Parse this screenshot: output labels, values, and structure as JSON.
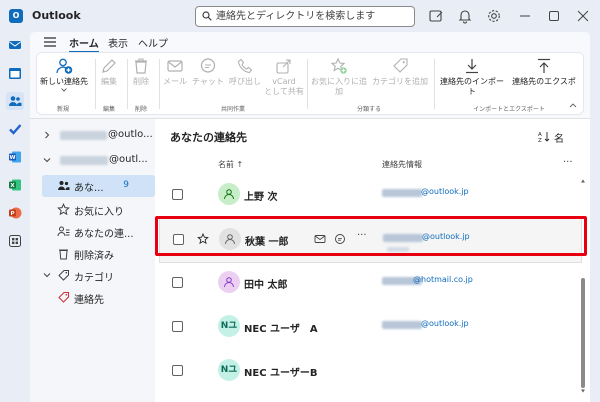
{
  "app": {
    "title": "Outlook",
    "logo_text": "O"
  },
  "search": {
    "placeholder": "連絡先とディレクトリを検索します"
  },
  "ribbon": {
    "tabs": [
      {
        "label": "ホーム",
        "active": true
      },
      {
        "label": "表示",
        "active": false
      },
      {
        "label": "ヘルプ",
        "active": false
      }
    ],
    "buttons": {
      "new_contact": "新しい連絡先",
      "edit": "編集",
      "delete": "削除",
      "mail": "メール",
      "chat": "チャット",
      "call": "呼び出し",
      "vcard_line1": "vCard",
      "vcard_line2": "として共有",
      "add_favorite": "お気に入りに追加",
      "add_category": "カテゴリを追加",
      "import_contacts": "連絡先のインポート",
      "export_contacts": "連絡先のエクスポ"
    },
    "groups": {
      "new": "新規",
      "edit": "編集",
      "delete": "削除",
      "collab": "共同作業",
      "classify": "分類する",
      "import_export": "インポートとエクスポート"
    }
  },
  "folders": {
    "account1_suffix": "@outlo...",
    "account2_suffix": "@outl...",
    "items": [
      {
        "label": "あな...",
        "badge": "9",
        "selected": true
      },
      {
        "label": "お気に入り"
      },
      {
        "label": "あなたの連..."
      },
      {
        "label": "削除済み"
      },
      {
        "label": "カテゴリ"
      },
      {
        "label": "連絡先"
      }
    ]
  },
  "list": {
    "title": "あなたの連絡先",
    "sort_label": "名",
    "col_name": "名前 ↑",
    "col_info": "連絡先情報",
    "more": "···",
    "contacts": [
      {
        "name": "上野 次",
        "domain": "@outlook.jp",
        "initials": "",
        "avatar_color": "#c7eec9"
      },
      {
        "name": "秋葉 一郎",
        "domain": "@outlook.jp",
        "initials": "",
        "avatar_color": "#e1e1e1"
      },
      {
        "name": "田中 太郎",
        "domain": "@hotmail.co.jp",
        "initials": "",
        "avatar_color": "#ecd0f2"
      },
      {
        "name": "NEC ユーザ　A",
        "domain": "@outlook.jp",
        "initials": "Nユ",
        "avatar_color": "#c3f1e5"
      },
      {
        "name": "NEC ユーザーB",
        "domain": "",
        "initials": "Nユ",
        "avatar_color": "#c3f1e5"
      }
    ]
  },
  "colors": {
    "accent": "#0f6cbd",
    "highlight": "#e60012"
  }
}
